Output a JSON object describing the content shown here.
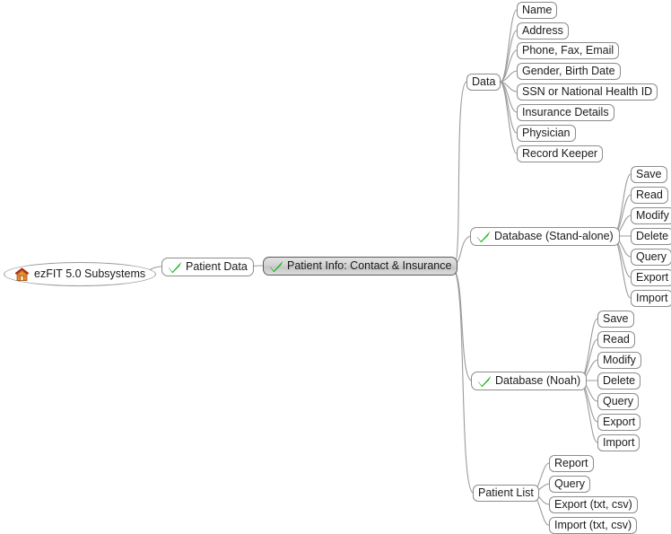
{
  "app": {
    "background_color": "#ffffff",
    "node_border_color": "#8c8c8c",
    "edge_color": "#9b9b9b",
    "check_color": "#22bb22",
    "selected_bg_color": "#d4d4d4",
    "selected_border_color": "#5b5b5b"
  },
  "root": {
    "label": "ezFIT 5.0 Subsystems",
    "icon": "home-icon"
  },
  "level1": {
    "label": "Patient Data",
    "icon": "check-icon"
  },
  "level2": {
    "label": "Patient Info: Contact & Insurance",
    "icon": "check-icon",
    "selected": true
  },
  "branches": [
    {
      "id": "data",
      "label": "Data",
      "icon": null,
      "children": [
        {
          "label": "Name"
        },
        {
          "label": "Address"
        },
        {
          "label": "Phone, Fax, Email"
        },
        {
          "label": "Gender, Birth Date"
        },
        {
          "label": "SSN or National Health ID"
        },
        {
          "label": "Insurance Details"
        },
        {
          "label": "Physician"
        },
        {
          "label": "Record Keeper"
        }
      ]
    },
    {
      "id": "database-standalone",
      "label": "Database (Stand-alone)",
      "icon": "check-icon",
      "children": [
        {
          "label": "Save"
        },
        {
          "label": "Read"
        },
        {
          "label": "Modify"
        },
        {
          "label": "Delete"
        },
        {
          "label": "Query"
        },
        {
          "label": "Export"
        },
        {
          "label": "Import"
        }
      ]
    },
    {
      "id": "database-noah",
      "label": "Database (Noah)",
      "icon": "check-icon",
      "children": [
        {
          "label": "Save"
        },
        {
          "label": "Read"
        },
        {
          "label": "Modify"
        },
        {
          "label": "Delete"
        },
        {
          "label": "Query"
        },
        {
          "label": "Export"
        },
        {
          "label": "Import"
        }
      ]
    },
    {
      "id": "patient-list",
      "label": "Patient List",
      "icon": null,
      "children": [
        {
          "label": "Report"
        },
        {
          "label": "Query"
        },
        {
          "label": "Export (txt, csv)"
        },
        {
          "label": "Import (txt, csv)"
        }
      ]
    }
  ]
}
